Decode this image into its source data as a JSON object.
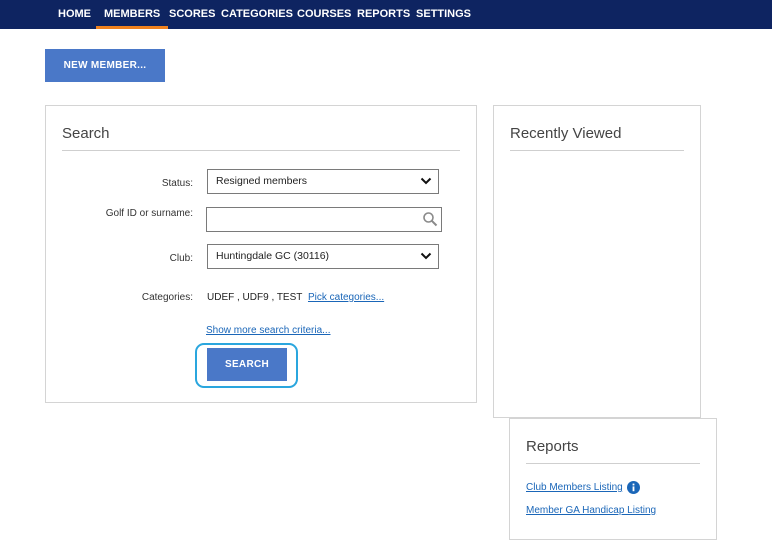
{
  "nav": {
    "items": [
      {
        "label": "HOME",
        "active": false
      },
      {
        "label": "MEMBERS",
        "active": true
      },
      {
        "label": "SCORES",
        "active": false
      },
      {
        "label": "CATEGORIES",
        "active": false
      },
      {
        "label": "COURSES",
        "active": false
      },
      {
        "label": "REPORTS",
        "active": false
      },
      {
        "label": "SETTINGS",
        "active": false
      }
    ]
  },
  "new_member_label": "NEW MEMBER...",
  "search": {
    "title": "Search",
    "status_label": "Status:",
    "status_value": "Resigned members",
    "golf_id_label": "Golf ID or surname:",
    "golf_id_value": "",
    "club_label": "Club:",
    "club_value": "Huntingdale GC (30116)",
    "categories_label": "Categories:",
    "categories_value": "UDEF , UDF9 , TEST",
    "pick_categories_link": "Pick categories...",
    "more_criteria_link": "Show more search criteria...",
    "search_button": "SEARCH"
  },
  "recently_viewed": {
    "title": "Recently Viewed"
  },
  "reports": {
    "title": "Reports",
    "links": [
      "Club Members Listing",
      "Member GA Handicap Listing"
    ]
  },
  "colors": {
    "nav_bg": "#0e2461",
    "nav_active_underline": "#f0821e",
    "button": "#4a78c8",
    "link": "#1a66b8",
    "focus_ring": "#2aa6de"
  },
  "icons": {
    "search_field": "magnifier-icon",
    "dropdown": "chevron-down-icon",
    "report_info": "info-icon"
  }
}
